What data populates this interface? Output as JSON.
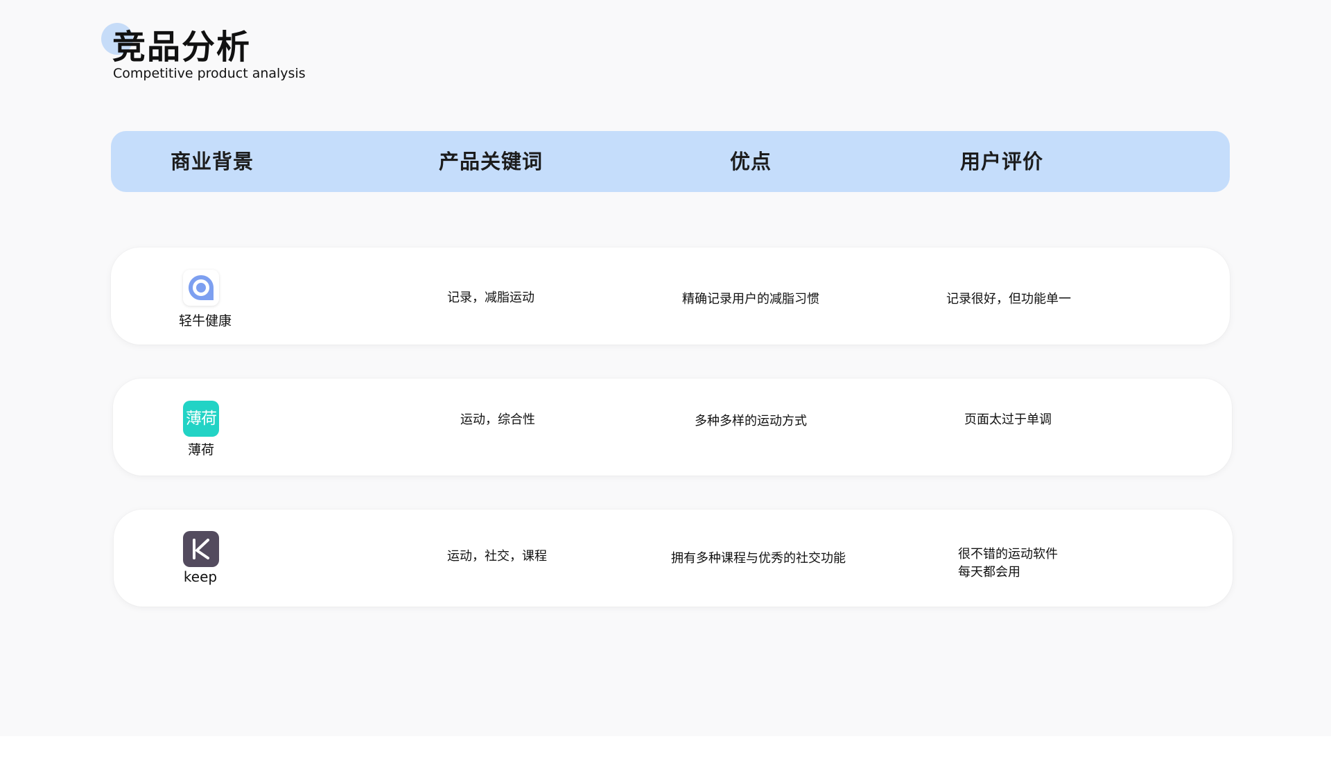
{
  "header": {
    "title": "竞品分析",
    "subtitle": "Competitive product analysis"
  },
  "table": {
    "columns": [
      "商业背景",
      "产品关键词",
      "优点",
      "用户评价"
    ],
    "rows": [
      {
        "app_name": "轻牛健康",
        "keywords": "记录，减脂运动",
        "advantages": "精确记录用户的减脂习惯",
        "reviews": [
          "记录很好，但功能单一"
        ]
      },
      {
        "app_name": "薄荷",
        "icon_text": "薄荷",
        "keywords": "运动，综合性",
        "advantages": "多种多样的运动方式",
        "reviews": [
          "页面太过于单调"
        ]
      },
      {
        "app_name": "keep",
        "keywords": "运动，社交，课程",
        "advantages": "拥有多种课程与优秀的社交功能",
        "reviews": [
          "很不错的运动软件",
          "每天都会用"
        ]
      }
    ]
  },
  "icons": [
    "qingniu-app-icon",
    "bohe-app-icon",
    "keep-app-icon"
  ],
  "colors": {
    "background": "#f9f9fa",
    "header_bar": "#c5ddfb",
    "title_dot": "#c6dcf8",
    "qingniu_icon": "#7d9ff0",
    "bohe_icon": "#22d3c5",
    "keep_icon": "#534b5e"
  }
}
